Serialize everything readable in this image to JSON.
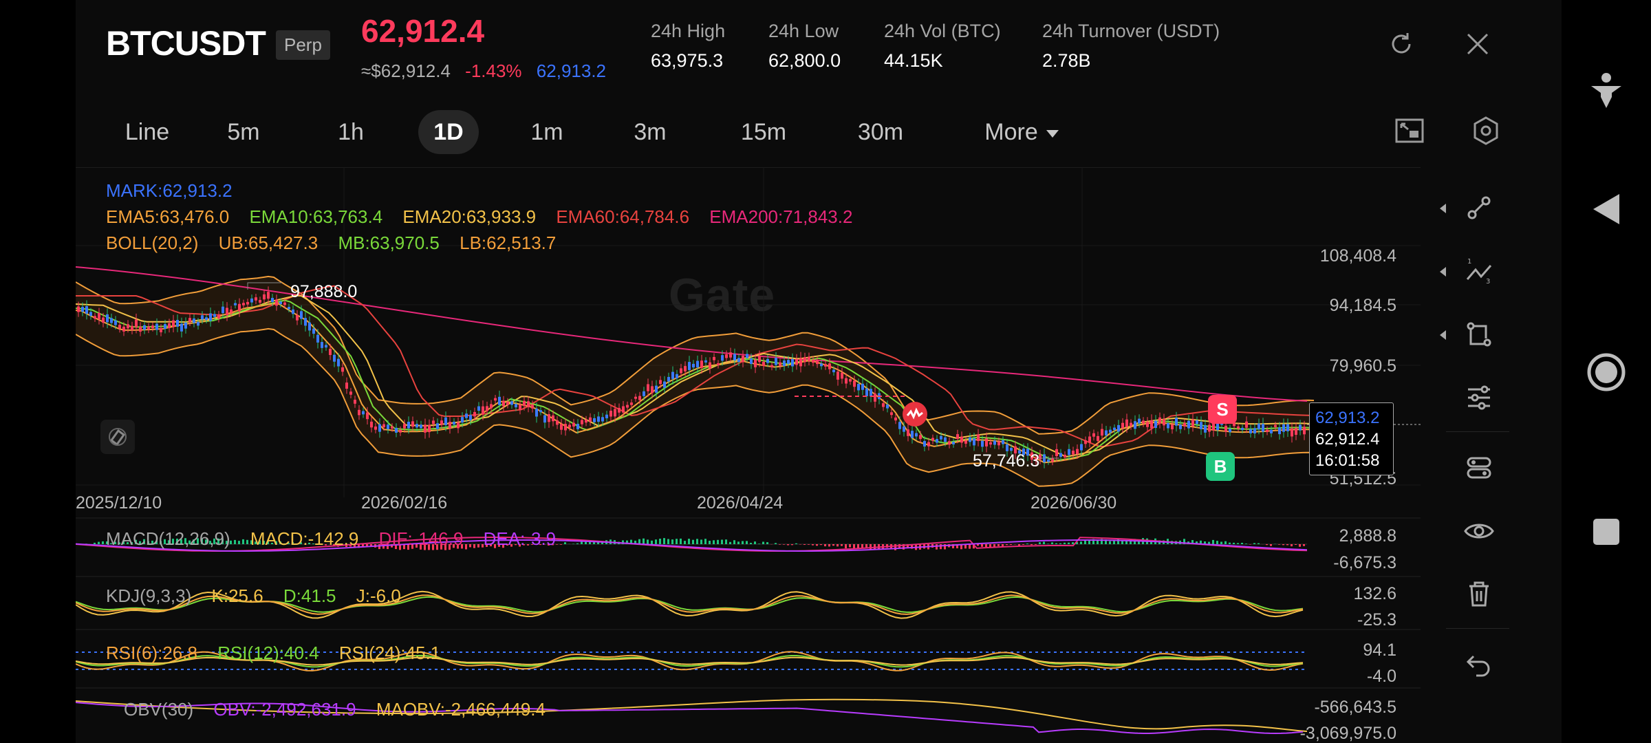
{
  "header": {
    "symbol": "BTCUSDT",
    "badge": "Perp",
    "last_price": "62,912.4",
    "fiat_price": "≈$62,912.4",
    "change": "-1.43%",
    "mark_price": "62,913.2",
    "stats": [
      {
        "label": "24h  High",
        "value": "63,975.3"
      },
      {
        "label": "24h  Low",
        "value": "62,800.0"
      },
      {
        "label": "24h  Vol (BTC)",
        "value": "44.15K"
      },
      {
        "label": "24h  Turnover (USDT)",
        "value": "2.78B"
      }
    ]
  },
  "intervals": [
    "Line",
    "5m",
    "1h",
    "1D",
    "1m",
    "3m",
    "15m",
    "30m"
  ],
  "active_interval": "1D",
  "more_label": "More",
  "colors": {
    "up": "#ff3b5c",
    "down": "#1fc57e",
    "blue": "#2f6bff",
    "ema5": "#f5a33b",
    "ema10": "#7ad93a",
    "ema20": "#f3c249",
    "ema60": "#e8433f",
    "ema200": "#e8287a",
    "boll": "#f29e3a",
    "purple": "#b83cff"
  },
  "main_chart": {
    "mark": "MARK:62,913.2",
    "ema": {
      "ema5": "EMA5:63,476.0",
      "ema10": "EMA10:63,763.4",
      "ema20": "EMA20:63,933.9",
      "ema60": "EMA60:64,784.6",
      "ema200": "EMA200:71,843.2"
    },
    "boll": {
      "name": "BOLL(20,2)",
      "ub": "UB:65,427.3",
      "mb": "MB:63,970.5",
      "lb": "LB:62,513.7"
    },
    "y_ticks": [
      "108,408.4",
      "94,184.5",
      "79,960.5",
      "51,512.5"
    ],
    "x_ticks": [
      "2025/12/10",
      "2026/02/16",
      "2026/04/24",
      "2026/06/30"
    ],
    "high_label": "97,888.0",
    "low_label": "57,746.3",
    "tag": {
      "mark": "62,913.2",
      "last": "62,912.4",
      "countdown": "16:01:58"
    },
    "sell_marker": "S",
    "buy_marker": "B",
    "watermark": "Gate"
  },
  "macd": {
    "name": "MACD(12,26,9)",
    "macd": "MACD:-142.9",
    "dif": "DIF:-146.9",
    "dea": "DEA:-3.9",
    "y_ticks": [
      "2,888.8",
      "-6,675.3"
    ]
  },
  "kdj": {
    "name": "KDJ(9,3,3)",
    "k": "K:25.6",
    "d": "D:41.5",
    "j": "J:-6.0",
    "y_ticks": [
      "132.6",
      "-25.3"
    ]
  },
  "rsi": {
    "rsi6": "RSI(6):26.8",
    "rsi12": "RSI(12):40.4",
    "rsi24": "RSI(24):45.1",
    "y_ticks": [
      "94.1",
      "-4.0"
    ]
  },
  "obv": {
    "name": "OBV(30)",
    "obv": "OBV:-2,492,631.9",
    "maobv": "MAOBV:-2,466,449.4",
    "y_ticks": [
      "-566,643.5",
      "-3,069,975.0"
    ]
  }
}
